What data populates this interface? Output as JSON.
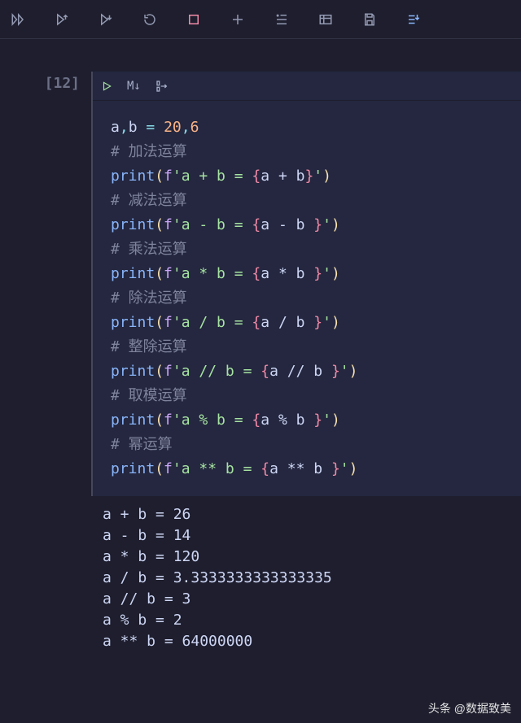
{
  "toolbar": {
    "icons": [
      "fast-forward",
      "play-up",
      "play-down",
      "restart",
      "stop",
      "add",
      "clear",
      "vars",
      "save",
      "export"
    ]
  },
  "cell": {
    "execution_count": "[12]",
    "toolbar": {
      "run": "▷",
      "markdown": "M↓",
      "split": "⫟"
    },
    "code": {
      "l1": {
        "a": "a",
        "comma": ",",
        "b": "b",
        "eq": "=",
        "v1": "20",
        "c2": ",",
        "v2": "6"
      },
      "l2": "# 加法运算",
      "l3": {
        "fn": "print",
        "open": "(",
        "f": "f",
        "s1": "'a + b = ",
        "bo": "{",
        "exp": "a + b",
        "bc": "}",
        "s2": "'",
        "close": ")"
      },
      "l4": "# 减法运算",
      "l5": {
        "fn": "print",
        "open": "(",
        "f": "f",
        "s1": "'a - b = ",
        "bo": "{",
        "exp": "a - b ",
        "bc": "}",
        "s2": "'",
        "close": ")"
      },
      "l6": "# 乘法运算",
      "l7": {
        "fn": "print",
        "open": "(",
        "f": "f",
        "s1": "'a * b = ",
        "bo": "{",
        "exp": "a * b ",
        "bc": "}",
        "s2": "'",
        "close": ")"
      },
      "l8": "# 除法运算",
      "l9": {
        "fn": "print",
        "open": "(",
        "f": "f",
        "s1": "'a / b = ",
        "bo": "{",
        "exp": "a / b ",
        "bc": "}",
        "s2": "'",
        "close": ")"
      },
      "l10": "# 整除运算",
      "l11": {
        "fn": "print",
        "open": "(",
        "f": "f",
        "s1": "'a // b = ",
        "bo": "{",
        "exp": "a // b ",
        "bc": "}",
        "s2": "'",
        "close": ")"
      },
      "l12": "# 取模运算",
      "l13": {
        "fn": "print",
        "open": "(",
        "f": "f",
        "s1": "'a % b = ",
        "bo": "{",
        "exp": "a % b ",
        "bc": "}",
        "s2": "'",
        "close": ")"
      },
      "l14": "# 幂运算",
      "l15": {
        "fn": "print",
        "open": "(",
        "f": "f",
        "s1": "'a ** b = ",
        "bo": "{",
        "exp": "a ** b ",
        "bc": "}",
        "s2": "'",
        "close": ")"
      }
    }
  },
  "output": {
    "l1": "a + b = 26",
    "l2": "a - b = 14",
    "l3": "a * b = 120",
    "l4": "a / b = 3.3333333333333335",
    "l5": "a // b = 3",
    "l6": "a % b = 2",
    "l7": "a ** b = 64000000"
  },
  "watermark": "头条 @数据致美"
}
